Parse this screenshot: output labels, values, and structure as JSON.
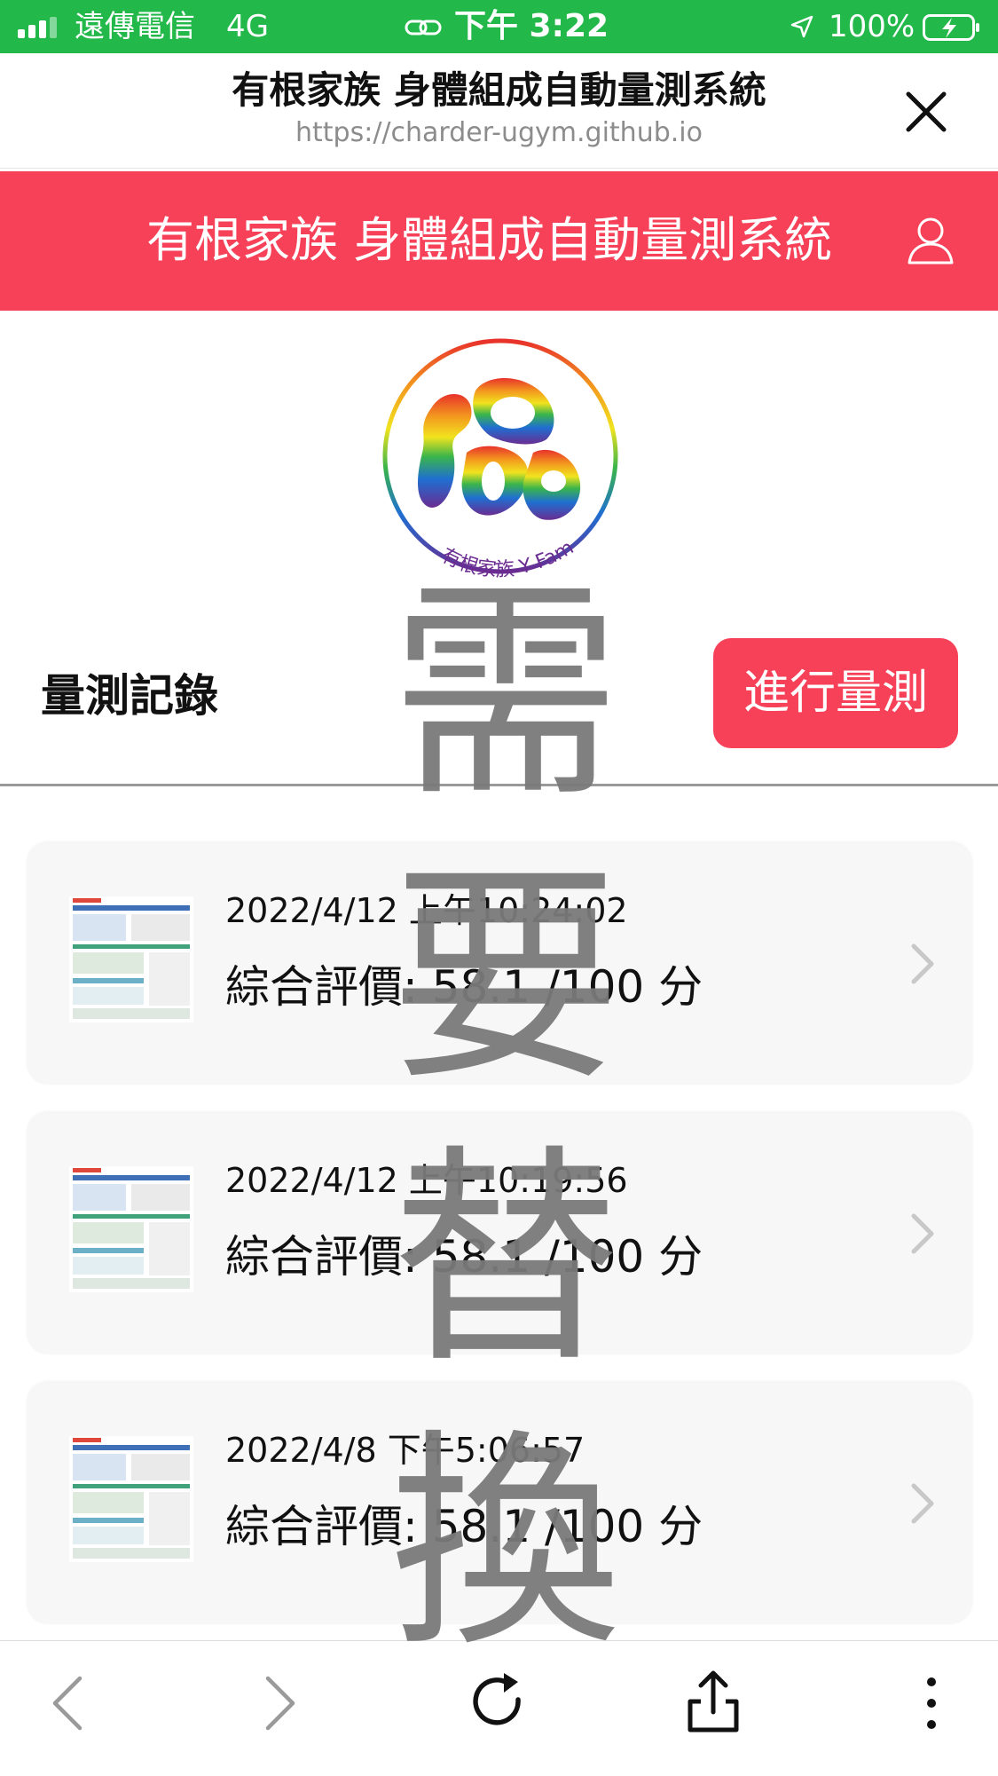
{
  "status_bar": {
    "carrier": "遠傳電信",
    "network": "4G",
    "time": "下午 3:22",
    "battery": "100%"
  },
  "browser": {
    "page_title": "有根家族 身體組成自動量測系統",
    "url": "https://charder-ugym.github.io"
  },
  "app": {
    "header_title": "有根家族 身體組成自動量測系統",
    "accent_color": "#f64158",
    "logo_text": "有根家族 Y Family"
  },
  "watermark": [
    "需",
    "要",
    "替",
    "換"
  ],
  "records": {
    "title": "量測記錄",
    "measure_button": "進行量測",
    "items": [
      {
        "date": "2022/4/12 上午10:24:02",
        "score": "綜合評價: 58.1 /100 分"
      },
      {
        "date": "2022/4/12 上午10:19:56",
        "score": "綜合評價: 58.1 /100 分"
      },
      {
        "date": "2022/4/8 下午5:06:57",
        "score": "綜合評價: 58.1 /100 分"
      }
    ]
  },
  "toolbar": {
    "icons": [
      "back-icon",
      "forward-icon",
      "reload-icon",
      "share-icon",
      "more-icon"
    ]
  }
}
